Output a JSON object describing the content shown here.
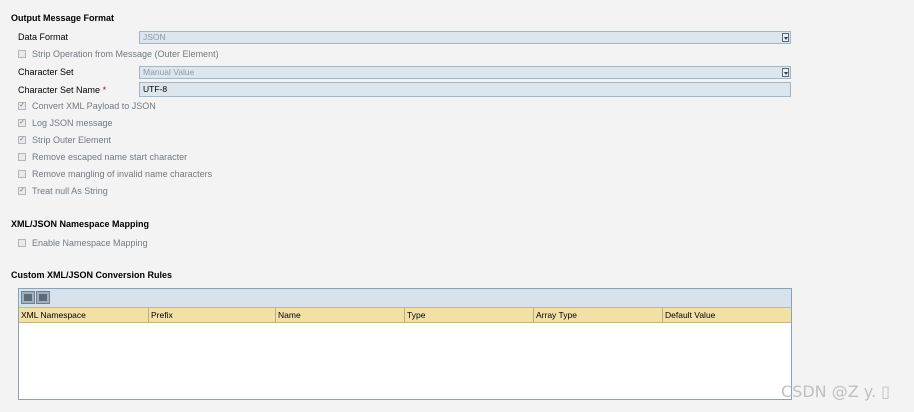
{
  "output_format": {
    "title": "Output Message Format",
    "data_format_label": "Data Format",
    "data_format_value": "JSON",
    "strip_operation_label": "Strip Operation from Message (Outer Element)",
    "character_set_label": "Character Set",
    "character_set_value": "Manual Value",
    "character_set_name_label": "Character Set Name",
    "required_mark": "*",
    "character_set_name_value": "UTF-8",
    "options": [
      {
        "label": "Convert XML Payload to JSON",
        "checked": true
      },
      {
        "label": "Log JSON message",
        "checked": true
      },
      {
        "label": "Strip Outer Element",
        "checked": true
      },
      {
        "label": "Remove escaped name start character",
        "checked": false
      },
      {
        "label": "Remove mangling of invalid name characters",
        "checked": false
      },
      {
        "label": "Treat null As String",
        "checked": true
      }
    ]
  },
  "namespace_mapping": {
    "title": "XML/JSON Namespace Mapping",
    "enable_label": "Enable Namespace Mapping"
  },
  "conversion_rules": {
    "title": "Custom XML/JSON Conversion Rules",
    "columns": [
      "XML Namespace",
      "Prefix",
      "Name",
      "Type",
      "Array Type",
      "Default Value"
    ]
  },
  "watermark": "CSDN @Z y. ▯"
}
